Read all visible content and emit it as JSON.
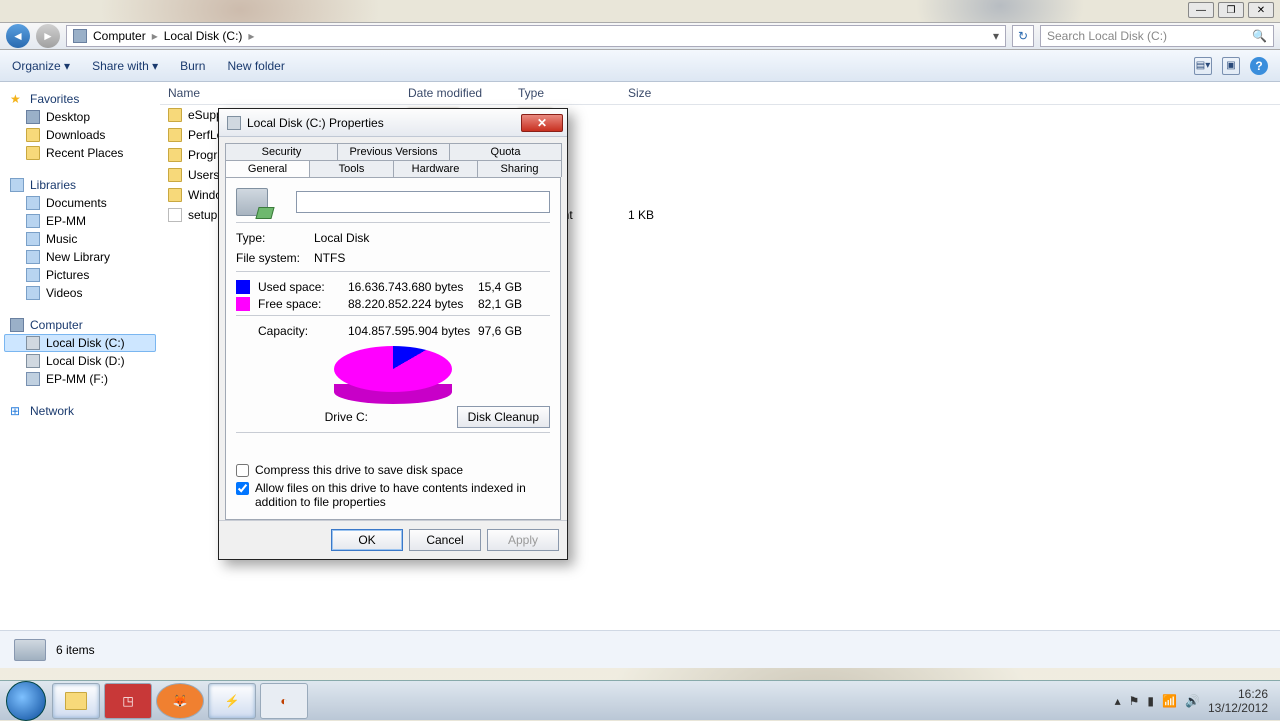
{
  "window_controls": {
    "min": "—",
    "max": "❐",
    "close": "✕"
  },
  "nav": {
    "crumb1": "Computer",
    "crumb2": "Local Disk (C:)",
    "search_placeholder": "Search Local Disk (C:)"
  },
  "toolbar": {
    "organize": "Organize ▾",
    "share": "Share with ▾",
    "burn": "Burn",
    "newfolder": "New folder"
  },
  "sidebar": {
    "favorites": "Favorites",
    "fav_items": [
      "Desktop",
      "Downloads",
      "Recent Places"
    ],
    "libraries": "Libraries",
    "lib_items": [
      "Documents",
      "EP-MM",
      "Music",
      "New Library",
      "Pictures",
      "Videos"
    ],
    "computer": "Computer",
    "drives": [
      "Local Disk (C:)",
      "Local Disk (D:)",
      "EP-MM (F:)"
    ],
    "network": "Network"
  },
  "columns": {
    "name": "Name",
    "date": "Date modified",
    "type": "Type",
    "size": "Size"
  },
  "files": {
    "rows": [
      {
        "name": "eSupport",
        "size": ""
      },
      {
        "name": "PerfLogs",
        "size": ""
      },
      {
        "name": "Program Files",
        "size": ""
      },
      {
        "name": "Users",
        "size": ""
      },
      {
        "name": "Windows",
        "size": ""
      },
      {
        "name": "setup",
        "type": "Document",
        "size": "1 KB"
      }
    ]
  },
  "status": {
    "text": "6 items"
  },
  "clock": {
    "time": "16:26",
    "date": "13/12/2012"
  },
  "dialog": {
    "title": "Local Disk (C:) Properties",
    "tabs_row1": [
      "Security",
      "Previous Versions",
      "Quota"
    ],
    "tabs_row2": [
      "General",
      "Tools",
      "Hardware",
      "Sharing"
    ],
    "type_label": "Type:",
    "type_value": "Local Disk",
    "fs_label": "File system:",
    "fs_value": "NTFS",
    "used_label": "Used space:",
    "used_bytes": "16.636.743.680 bytes",
    "used_gb": "15,4 GB",
    "free_label": "Free space:",
    "free_bytes": "88.220.852.224 bytes",
    "free_gb": "82,1 GB",
    "cap_label": "Capacity:",
    "cap_bytes": "104.857.595.904 bytes",
    "cap_gb": "97,6 GB",
    "drive_label": "Drive C:",
    "cleanup": "Disk Cleanup",
    "compress": "Compress this drive to save disk space",
    "index": "Allow files on this drive to have contents indexed in addition to file properties",
    "ok": "OK",
    "cancel": "Cancel",
    "apply": "Apply"
  },
  "chart_data": {
    "type": "pie",
    "title": "Drive C:",
    "series": [
      {
        "name": "Used space",
        "value_bytes": 16636743680,
        "value_gb": 15.4,
        "color": "#0000ff"
      },
      {
        "name": "Free space",
        "value_bytes": 88220852224,
        "value_gb": 82.1,
        "color": "#ff00ff"
      }
    ],
    "total": {
      "name": "Capacity",
      "value_bytes": 104857595904,
      "value_gb": 97.6
    }
  }
}
